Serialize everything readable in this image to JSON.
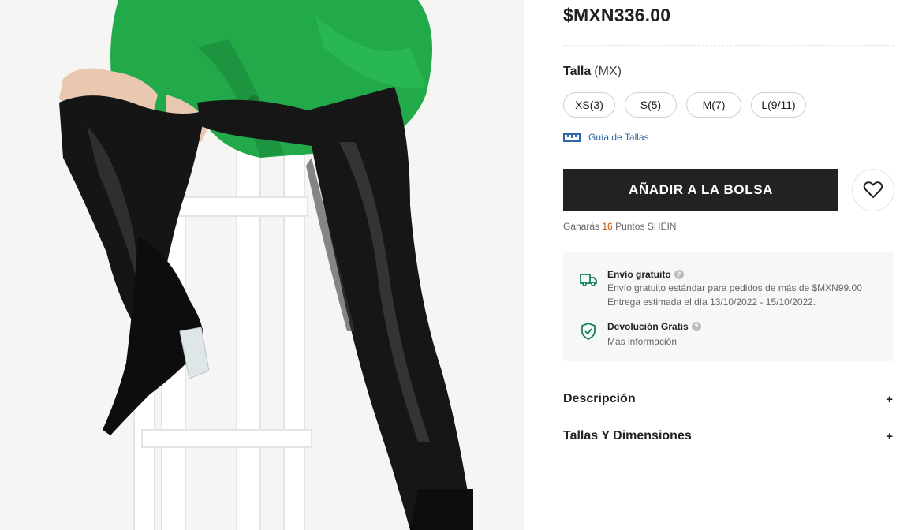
{
  "product": {
    "price": "$MXN336.00",
    "image_icon": "product-photo-leather-pants"
  },
  "size": {
    "label": "Talla",
    "unit": "(MX)",
    "options": [
      "XS(3)",
      "S(5)",
      "M(7)",
      "L(9/11)"
    ],
    "guide_label": "Guía de Tallas",
    "guide_icon": "ruler-icon"
  },
  "actions": {
    "add_to_bag_label": "AÑADIR A LA BOLSA",
    "wishlist_icon": "heart-icon"
  },
  "points": {
    "prefix": "Ganarás",
    "value": "16",
    "suffix": "Puntos SHEIN"
  },
  "shipping": {
    "free_title": "Envío gratuito",
    "free_line1": "Envío gratuito estándar para pedidos de más de $MXN99.00",
    "free_line2": "Entrega estimada el día 13/10/2022 - 15/10/2022.",
    "return_title": "Devolución Gratis",
    "return_line": "Más información",
    "truck_icon": "truck-icon",
    "shield_icon": "shield-check-icon",
    "help_icon": "question-icon"
  },
  "accordions": [
    {
      "label": "Descripción",
      "toggle": "+"
    },
    {
      "label": "Tallas Y Dimensiones",
      "toggle": "+"
    }
  ],
  "colors": {
    "accent_dark": "#222222",
    "points_orange": "#c44a01",
    "link_blue": "#2d68a8",
    "shield_green": "#198055"
  }
}
